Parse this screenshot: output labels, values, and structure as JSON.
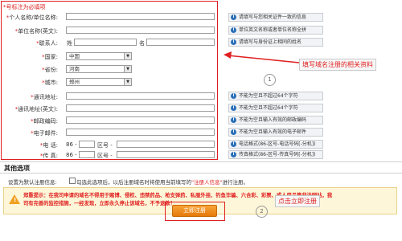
{
  "form": {
    "note": "*号标注为必填项",
    "fields": [
      {
        "label": "个人名称/单位名称:",
        "required": true
      },
      {
        "label": "单位名称(英文):",
        "required": true
      },
      {
        "label": "联系人:",
        "required": true,
        "last_label": "姓",
        "first_label": "名"
      },
      {
        "label": "国家:",
        "required": true,
        "value": "中国"
      },
      {
        "label": "省份:",
        "required": true,
        "value": "河南"
      },
      {
        "label": "城市:",
        "required": true,
        "value": "郑州"
      },
      {
        "label": "通讯地址:",
        "required": true
      },
      {
        "label": "通讯地址(英文):",
        "required": true
      },
      {
        "label": "邮政编码:",
        "required": true
      },
      {
        "label": "电子邮件:",
        "required": true
      },
      {
        "label": "电 话:",
        "required": true,
        "prefix": "86 -",
        "mid": "区号 -"
      },
      {
        "label": "传 真:",
        "required": true,
        "prefix": "86 -",
        "mid": "区号 -"
      }
    ]
  },
  "hints": [
    "请填写与您相关证件一致的信息",
    "单位英文名称或者单位名称全拼",
    "请填写与身份证上相同的姓名",
    "不能为空且不超过64个字符",
    "不能为空且不超过64个字符",
    "不能为空且输入有效的邮政编码",
    "不能为空且输入有效的电子邮件",
    "电话格式(86-区号-电话号码[-分机])",
    "传真格式(86-区号-传真号码[-分机])"
  ],
  "annotations": {
    "callout1": "填写域名注册的相关资料",
    "circle1": "1",
    "callout2": "点击立即注册",
    "circle2": "2"
  },
  "other": {
    "section_title": "其他选项",
    "default_label": "设置为默认注册信息:",
    "default_text": "勾选此选项后，以后注册域名时将使用当前填写的",
    "default_link": "\"注册人信息\"",
    "default_suffix": "进行注册。"
  },
  "warning": {
    "prefix": "郑重提示：",
    "text1": "在我司申请的域名不得用于赌博、侵权、违禁药品、枪支弹药、私服外挂、钓鱼诈骗、六合彩、彩票、成人用品等非法网站，我",
    "text2": "司有完善的监控措施，一经发现，立即永久停止该域名，不予退款！"
  },
  "submit": {
    "label": "立即注册"
  },
  "colors": {
    "accent_red": "#e02020",
    "button_orange": "#f08a12",
    "warn_bg": "#fdf6d8"
  }
}
